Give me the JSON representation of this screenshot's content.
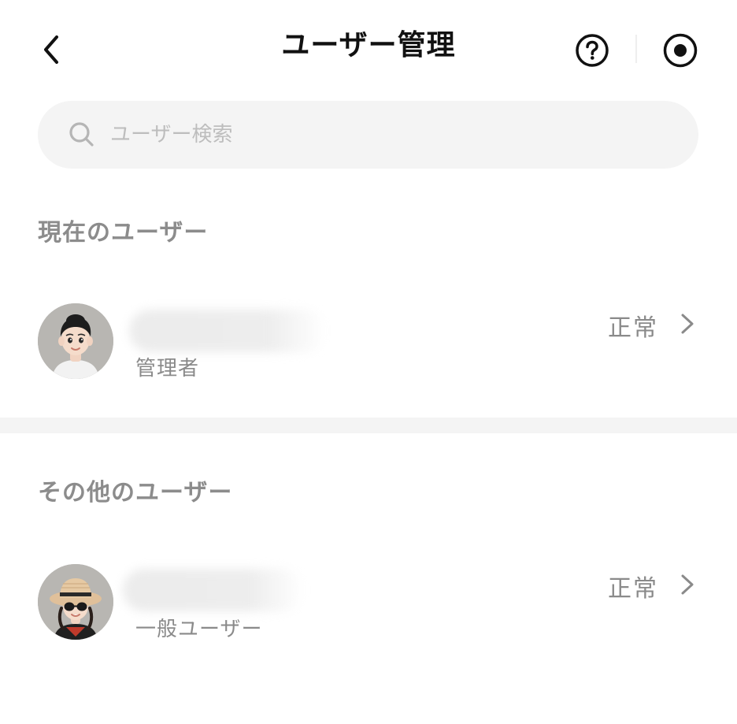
{
  "header": {
    "title": "ユーザー管理",
    "back_icon": "chevron-left-icon",
    "help_icon": "question-circle-icon",
    "record_icon": "record-circle-icon"
  },
  "search": {
    "placeholder": "ユーザー検索",
    "value": ""
  },
  "sections": [
    {
      "title": "現在のユーザー",
      "users": [
        {
          "name": "",
          "role": "管理者",
          "status": "正常",
          "avatar": "avatar-boy"
        }
      ]
    },
    {
      "title": "その他のユーザー",
      "users": [
        {
          "name": "",
          "role": "一般ユーザー",
          "status": "正常",
          "avatar": "avatar-hat-sunglasses"
        }
      ]
    }
  ],
  "colors": {
    "background": "#ffffff",
    "search_bg": "#f4f4f4",
    "section_title": "#8c8c8c",
    "secondary_text": "#8a8a8a",
    "divider_band": "#f4f4f4"
  }
}
